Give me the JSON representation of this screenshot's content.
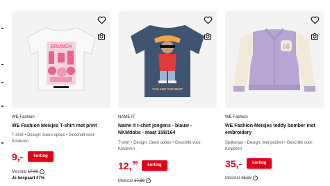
{
  "products": [
    {
      "brand": "WE Fashion",
      "title": "WE Fashion Meisjes T-shirt met print",
      "specs": "T-shirt • Design: Geen opties • Geschikt voor: Kinderen",
      "price_main": "9,-",
      "price_cents": "",
      "badge": "korting",
      "was_label": "Meestal",
      "was_price": "17,00",
      "saving": "Je bespaart 47%",
      "shirt_color": "#f7f7f7",
      "print_color": "#e8638f",
      "print_text": "BRUNCH"
    },
    {
      "brand": "NAME IT",
      "title": "Name it t-shirt jongens - blauw - NKMdobs - maat 158/164",
      "specs": "T-shirt • Design: Geen opties • Geschikt voor: Kinderen",
      "price_main": "12,",
      "price_cents": "99",
      "badge": "korting",
      "was_label": "Meestal",
      "was_price": "17,99",
      "saving": "",
      "shirt_color": "#3f5471",
      "print_color": "#e23a36",
      "print_text": "YOU ARE THE BEST"
    },
    {
      "brand": "WE Fashion",
      "title": "WE Fashion Meisjes teddy bomber met embroidery",
      "specs": "Spijkerjas • Design: Met pochet • Geschikt voor: Kinderen",
      "price_main": "35,-",
      "price_cents": "",
      "badge": "korting",
      "was_label": "Meestal",
      "was_price": "49,00",
      "saving": "",
      "shirt_color": "#b7a6d3",
      "print_color": "#f1ead9",
      "print_text": "66"
    }
  ],
  "icons": {
    "favorite": "heart-outline-icon",
    "visual_search": "camera-search-icon",
    "info": "info-circle-icon"
  },
  "colors": {
    "accent": "#e0001b",
    "image_bg": "#f3f3f4"
  }
}
